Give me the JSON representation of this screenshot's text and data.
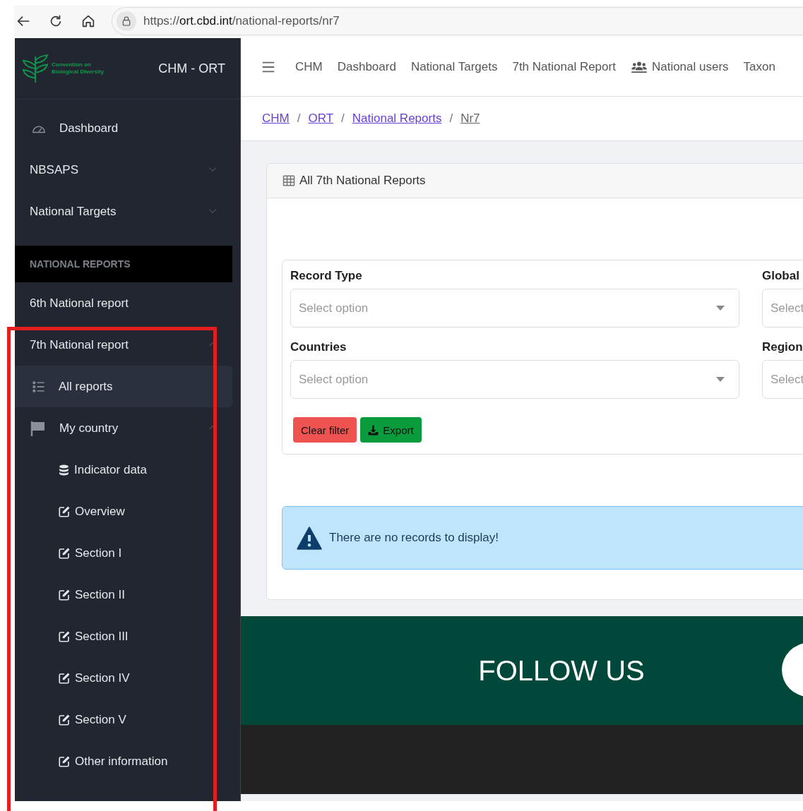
{
  "browser": {
    "url": {
      "scheme": "https://",
      "host": "ort.cbd.int",
      "path": "/national-reports/nr7"
    }
  },
  "sidebar": {
    "logo_text": "Convention on Biological Diversity",
    "title": "CHM - ORT",
    "items": [
      {
        "kind": "link",
        "label": "Dashboard",
        "selected": false
      },
      {
        "kind": "group",
        "label": "NBSAPS",
        "expanded": false
      },
      {
        "kind": "group",
        "label": "National Targets",
        "expanded": false
      },
      {
        "kind": "header",
        "label": "NATIONAL REPORTS"
      },
      {
        "kind": "link",
        "label": "6th National report",
        "selected": false
      },
      {
        "kind": "group",
        "label": "7th National report",
        "expanded": true,
        "children": [
          {
            "kind": "link",
            "label": "All reports",
            "selected": true
          },
          {
            "kind": "group",
            "label": "My country",
            "expanded": true,
            "children": [
              {
                "kind": "link",
                "label": "Indicator data",
                "selected": false
              },
              {
                "kind": "link",
                "label": "Overview",
                "selected": false
              },
              {
                "kind": "link",
                "label": "Section I",
                "selected": false
              },
              {
                "kind": "link",
                "label": "Section II",
                "selected": false
              },
              {
                "kind": "link",
                "label": "Section III",
                "selected": false
              },
              {
                "kind": "link",
                "label": "Section IV",
                "selected": false
              },
              {
                "kind": "link",
                "label": "Section V",
                "selected": false
              },
              {
                "kind": "link",
                "label": "Other information",
                "selected": false
              }
            ]
          }
        ]
      }
    ]
  },
  "top_nav": {
    "items": [
      {
        "kind": "link",
        "label": "CHM"
      },
      {
        "kind": "link",
        "label": "Dashboard"
      },
      {
        "kind": "link",
        "label": "National Targets"
      },
      {
        "kind": "link",
        "label": "7th National Report"
      },
      {
        "kind": "icon-link",
        "label": "National users"
      },
      {
        "kind": "link",
        "label": "Taxon"
      }
    ]
  },
  "breadcrumb": {
    "separator": "/",
    "items": [
      {
        "kind": "link",
        "label": "CHM"
      },
      {
        "kind": "link",
        "label": "ORT"
      },
      {
        "kind": "link",
        "label": "National Reports"
      },
      {
        "kind": "current",
        "label": "Nr7"
      }
    ]
  },
  "card": {
    "title": "All 7th National Reports",
    "filters": [
      {
        "label": "Record Type",
        "placeholder": "Select option"
      },
      {
        "label": "Global",
        "placeholder": "Select"
      },
      {
        "label": "Countries",
        "placeholder": "Select option"
      },
      {
        "label": "Region",
        "placeholder": "Select"
      }
    ],
    "buttons": [
      {
        "kind": "danger",
        "label": "Clear filter"
      },
      {
        "kind": "export",
        "label": "Export"
      }
    ],
    "alert": "There are no records to display!"
  },
  "footer": {
    "title": "FOLLOW US"
  }
}
